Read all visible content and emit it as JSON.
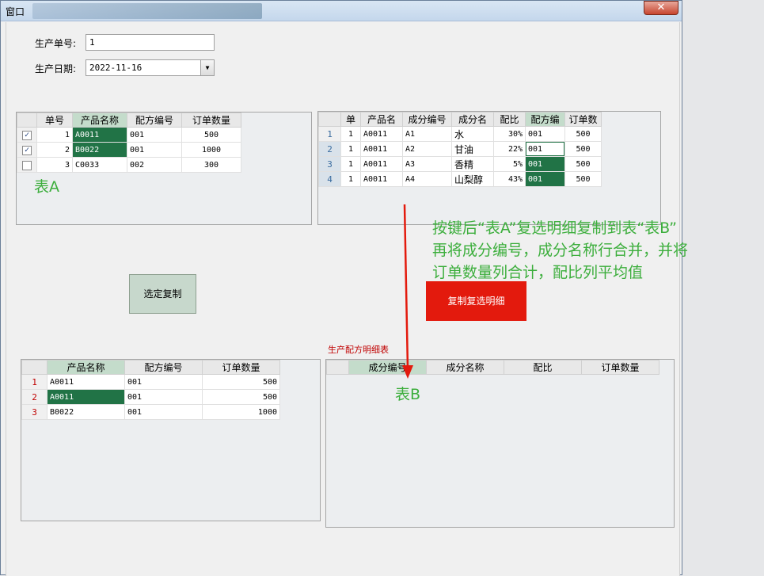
{
  "window": {
    "title": "窗口",
    "close": "✕"
  },
  "form": {
    "order_no_label": "生产单号:",
    "order_no_value": "1",
    "date_label": "生产日期:",
    "date_value": "2022-11-16"
  },
  "table_a": {
    "columns": [
      "单号",
      "产品名称",
      "配方编号",
      "订单数量"
    ],
    "rows": [
      {
        "checked": true,
        "no": "1",
        "product": "A0011",
        "formula": "001",
        "qty": "500"
      },
      {
        "checked": true,
        "no": "2",
        "product": "B0022",
        "formula": "001",
        "qty": "1000"
      },
      {
        "checked": false,
        "no": "3",
        "product": "C0033",
        "formula": "002",
        "qty": "300"
      }
    ],
    "label": "表A"
  },
  "detail_grid": {
    "columns": [
      "单",
      "产品名",
      "成分编号",
      "成分名",
      "配比",
      "配方编",
      "订单数"
    ],
    "rows": [
      {
        "idx": "1",
        "no": "1",
        "product": "A0011",
        "code": "A1",
        "name": "水",
        "ratio": "30%",
        "formula": "001",
        "qty": "500"
      },
      {
        "idx": "2",
        "no": "1",
        "product": "A0011",
        "code": "A2",
        "name": "甘油",
        "ratio": "22%",
        "formula": "001",
        "qty": "500"
      },
      {
        "idx": "3",
        "no": "1",
        "product": "A0011",
        "code": "A3",
        "name": "香精",
        "ratio": "5%",
        "formula": "001",
        "qty": "500"
      },
      {
        "idx": "4",
        "no": "1",
        "product": "A0011",
        "code": "A4",
        "name": "山梨醇",
        "ratio": "43%",
        "formula": "001",
        "qty": "500"
      }
    ]
  },
  "annotation": {
    "line1": "按键后“表A”复选明细复制到表“表B”",
    "line2": "再将成分编号，成分名称行合并，并将",
    "line3": "订单数量列合计，配比列平均值"
  },
  "buttons": {
    "copy_selected": "选定复制",
    "copy_checked_detail": "复制复选明细"
  },
  "copied_grid": {
    "columns": [
      "产品名称",
      "配方编号",
      "订单数量"
    ],
    "rows": [
      {
        "idx": "1",
        "product": "A0011",
        "formula": "001",
        "qty": "500"
      },
      {
        "idx": "2",
        "product": "A0011",
        "formula": "001",
        "qty": "500"
      },
      {
        "idx": "3",
        "product": "B0022",
        "formula": "001",
        "qty": "1000"
      }
    ]
  },
  "table_b": {
    "caption": "生产配方明细表",
    "columns": [
      "成分编号",
      "成分名称",
      "配比",
      "订单数量"
    ],
    "label": "表B"
  },
  "colors": {
    "accent_green": "#217346",
    "note_green": "#3cae3c",
    "red": "#e31a0d"
  }
}
